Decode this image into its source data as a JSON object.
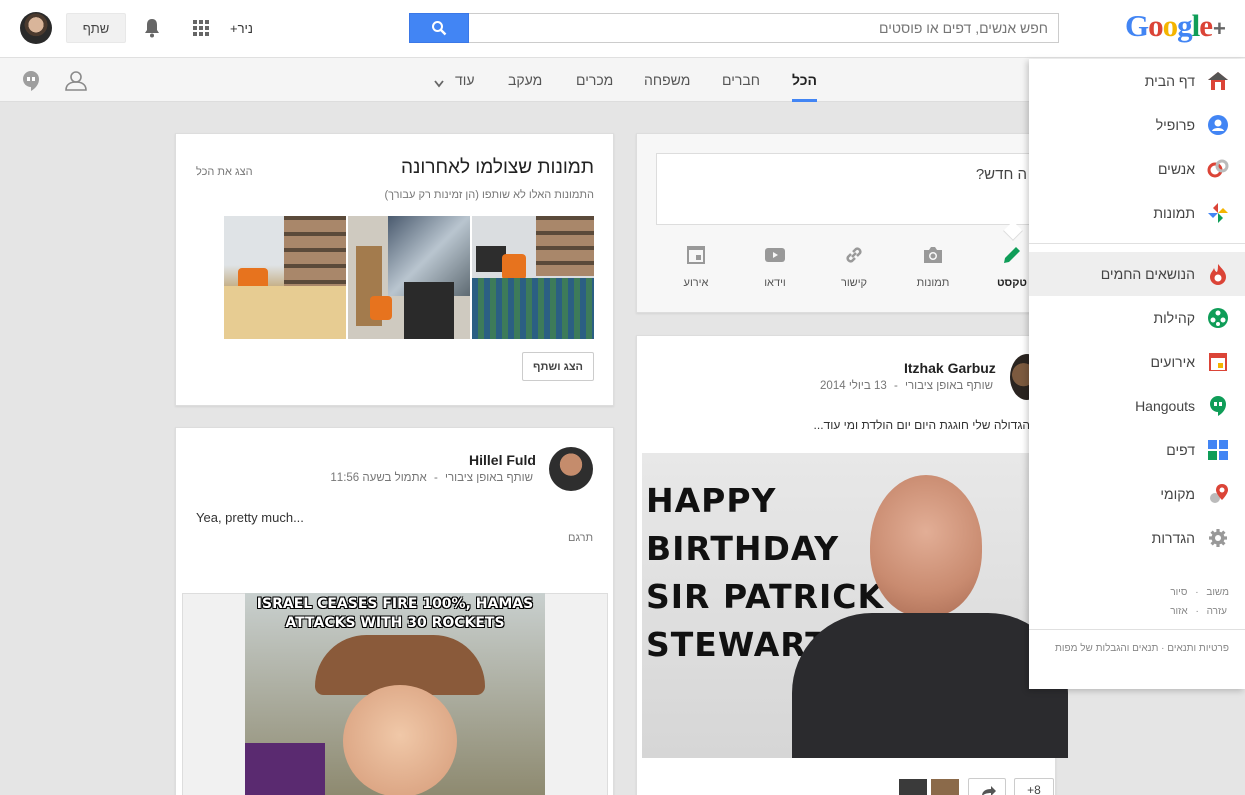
{
  "header": {
    "logo_text": "Google",
    "logo_plus": "+",
    "search_placeholder": "חפש אנשים, דפים או פוסטים",
    "user_link": "+ניר",
    "share_label": "שתף"
  },
  "nav": {
    "tabs": [
      {
        "label": "הכל",
        "active": true
      },
      {
        "label": "חברים"
      },
      {
        "label": "משפחה"
      },
      {
        "label": "מכרים"
      },
      {
        "label": "מעקב"
      },
      {
        "label": "עוד"
      }
    ]
  },
  "compose": {
    "prompt": "ה חדש?",
    "tools": [
      {
        "label": "טקסט",
        "icon": "pencil-icon"
      },
      {
        "label": "תמונות",
        "icon": "camera-icon"
      },
      {
        "label": "קישור",
        "icon": "link-icon"
      },
      {
        "label": "וידאו",
        "icon": "video-icon"
      },
      {
        "label": "אירוע",
        "icon": "event-icon"
      }
    ]
  },
  "recent_photos": {
    "title": "תמונות שצולמו לאחרונה",
    "subtitle": "התמונות האלו לא שותפו (הן זמינות רק עבורך)",
    "show_all": "הצג את הכל",
    "share_button": "הצג ושתף"
  },
  "post1": {
    "author": "Itzhak Garbuz",
    "meta_visibility": "שותף באופן ציבורי",
    "meta_sep": "-",
    "meta_date": "13 ביולי 2014",
    "text": "הגדולה שלי חוגגת היום יום הולדת ומי עוד...",
    "image_lines": [
      "HAPPY",
      "BIRTHDAY",
      "SIR PATRICK",
      "STEWART"
    ],
    "plus_count": "+8"
  },
  "post2": {
    "author": "Hillel Fuld",
    "meta_visibility": "שותף באופן ציבורי",
    "meta_sep": "-",
    "meta_date": "אתמול בשעה 11:56",
    "text": "Yea, pretty much...",
    "translate": "תרגם",
    "meme_text": "ISRAEL CEASES FIRE 100%, HAMAS ATTACKS WITH 30 ROCKETS"
  },
  "side_menu": {
    "items": [
      {
        "label": "דף הבית",
        "icon": "home-icon"
      },
      {
        "label": "פרופיל",
        "icon": "profile-icon"
      },
      {
        "label": "אנשים",
        "icon": "people-icon"
      },
      {
        "label": "תמונות",
        "icon": "photos-icon"
      },
      {
        "label": "הנושאים החמים",
        "icon": "hot-topics-icon"
      },
      {
        "label": "קהילות",
        "icon": "communities-icon"
      },
      {
        "label": "אירועים",
        "icon": "events-icon"
      },
      {
        "label": "Hangouts",
        "icon": "hangouts-icon"
      },
      {
        "label": "דפים",
        "icon": "pages-icon"
      },
      {
        "label": "מקומי",
        "icon": "local-icon"
      },
      {
        "label": "הגדרות",
        "icon": "settings-icon"
      }
    ],
    "footer_links": [
      "משוב",
      "סיור",
      "עזרה",
      "אזור"
    ],
    "footer_sep": "·",
    "footer_legal": "פרטיות ותנאים · תנאים והגבלות של מפות"
  },
  "colors": {
    "accent": "#4285f4",
    "background": "#e5e5e5",
    "red": "#db4437",
    "green": "#0f9d58"
  }
}
